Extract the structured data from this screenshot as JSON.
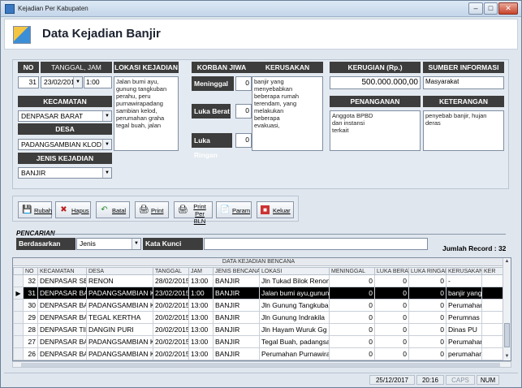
{
  "window": {
    "title": "Kejadian Per Kabupaten",
    "min": "–",
    "max": "□",
    "close": "✕"
  },
  "header": {
    "title": "Data Kejadian Banjir"
  },
  "form": {
    "no": {
      "label": "NO",
      "value": "31"
    },
    "tanggal": {
      "label": "TANGGAL, JAM KEJADIAN",
      "date": "23/02/2015",
      "time": "1:00"
    },
    "lokasi": {
      "label": "LOKASI KEJADIAN",
      "value": "Jalan bumi ayu,\ngunung tangkuban\nperahu, peru\npurnawirapadang\nsambian kelod,\nperumahan graha\ntegal buah, jalan"
    },
    "korban": {
      "label": "KORBAN JIWA",
      "meninggal": {
        "label": "Meninggal",
        "value": "0"
      },
      "luka_berat": {
        "label": "Luka Berat",
        "value": "0"
      },
      "luka_ringan": {
        "label": "Luka Ringan",
        "value": "0"
      }
    },
    "kerusakan": {
      "label": "KERUSAKAN",
      "value": "banjir yang\nmenyebabkan\nbeberapa rumah\nterendam, yang\nmelakukan\nbeberapa\nevakuasi,"
    },
    "kerugian": {
      "label": "KERUGIAN (Rp.)",
      "value": "500.000.000,00"
    },
    "sumber": {
      "label": "SUMBER INFORMASI",
      "value": "Masyarakat"
    },
    "penanganan": {
      "label": "PENANGANAN",
      "value": "Anggota BPBD\ndan instansi\nterkait"
    },
    "keterangan": {
      "label": "KETERANGAN",
      "value": "penyebab banjir, hujan deras"
    },
    "kecamatan": {
      "label": "KECAMATAN",
      "value": "DENPASAR BARAT"
    },
    "desa": {
      "label": "DESA",
      "value": "PADANGSAMBIAN KLOD"
    },
    "jenis": {
      "label": "JENIS KEJADIAN",
      "value": "BANJIR"
    }
  },
  "toolbar": {
    "ubah": "Rubah",
    "hapus": "Hapus",
    "batal": "Batal",
    "print": "Print",
    "print_per_bln_1": "Print Per",
    "print_per_bln_2": "BLN",
    "param": "Param",
    "keluar": "Keluar"
  },
  "search": {
    "title": "PENCARIAN",
    "berdasarkan_label": "Berdasarkan",
    "berdasarkan_value": "Jenis",
    "kata_kunci_label": "Kata Kunci",
    "kata_kunci_value": "",
    "jumlah_record": "Jumlah Record : 32"
  },
  "grid": {
    "caption": "DATA KEJADIAN BENCANA",
    "columns": [
      "NO",
      "KECAMATAN",
      "DESA",
      "TANGGAL",
      "JAM",
      "JENIS BENCANA",
      "LOKASI",
      "MENINGGAL",
      "LUKA BERAT",
      "LUKA RINGAN",
      "KERUSAKAN",
      "KER"
    ],
    "rows": [
      {
        "ind": "",
        "no": "32",
        "kec": "DENPASAR SELATAN",
        "desa": "RENON",
        "tgl": "28/02/2015",
        "jam": "13:00",
        "jenis": "BANJIR",
        "lokasi": "Jln Tukad Bilok Renon",
        "m": "0",
        "lb": "0",
        "lr": "0",
        "kerusakan": "-"
      },
      {
        "ind": "▶",
        "no": "31",
        "kec": "DENPASAR BARAT",
        "desa": "PADANGSAMBIAN KLOD",
        "tgl": "23/02/2015",
        "jam": "1:00",
        "jenis": "BANJIR",
        "lokasi": "Jalan bumi ayu,gunung",
        "m": "0",
        "lb": "0",
        "lr": "0",
        "kerusakan": "banjir yang",
        "sel": true
      },
      {
        "ind": "",
        "no": "30",
        "kec": "DENPASAR BARAT",
        "desa": "PADANGSAMBIAN KLOD",
        "tgl": "20/02/2015",
        "jam": "13:00",
        "jenis": "BANJIR",
        "lokasi": "Jln Gunung Tangkuban",
        "m": "0",
        "lb": "0",
        "lr": "0",
        "kerusakan": "Perumahan"
      },
      {
        "ind": "",
        "no": "29",
        "kec": "DENPASAR BARAT",
        "desa": "TEGAL KERTHA",
        "tgl": "20/02/2015",
        "jam": "13:00",
        "jenis": "BANJIR",
        "lokasi": "Jln Gunung Indrakila",
        "m": "0",
        "lb": "0",
        "lr": "0",
        "kerusakan": "Perumnas"
      },
      {
        "ind": "",
        "no": "28",
        "kec": "DENPASAR TIMUR",
        "desa": "DANGIN PURI",
        "tgl": "20/02/2015",
        "jam": "13:00",
        "jenis": "BANJIR",
        "lokasi": "Jln Hayam Wuruk Gg N",
        "m": "0",
        "lb": "0",
        "lr": "0",
        "kerusakan": "Dinas PU"
      },
      {
        "ind": "",
        "no": "27",
        "kec": "DENPASAR BARAT",
        "desa": "PADANGSAMBIAN KLOD",
        "tgl": "20/02/2015",
        "jam": "13:00",
        "jenis": "BANJIR",
        "lokasi": "Tegal Buah, padangsar",
        "m": "0",
        "lb": "0",
        "lr": "0",
        "kerusakan": "Perumahan"
      },
      {
        "ind": "",
        "no": "26",
        "kec": "DENPASAR BARAT",
        "desa": "PADANGSAMBIAN KLOD",
        "tgl": "20/02/2015",
        "jam": "13:00",
        "jenis": "BANJIR",
        "lokasi": "Perumahan Purnawira",
        "m": "0",
        "lb": "0",
        "lr": "0",
        "kerusakan": "perumahan"
      }
    ]
  },
  "status": {
    "date": "25/12/2017",
    "time": "20:16",
    "caps": "CAPS",
    "num": "NUM"
  },
  "colors": {
    "header_dark": "#3d3d3d",
    "selected_row": "#000000",
    "background": "#dfe6ee"
  }
}
